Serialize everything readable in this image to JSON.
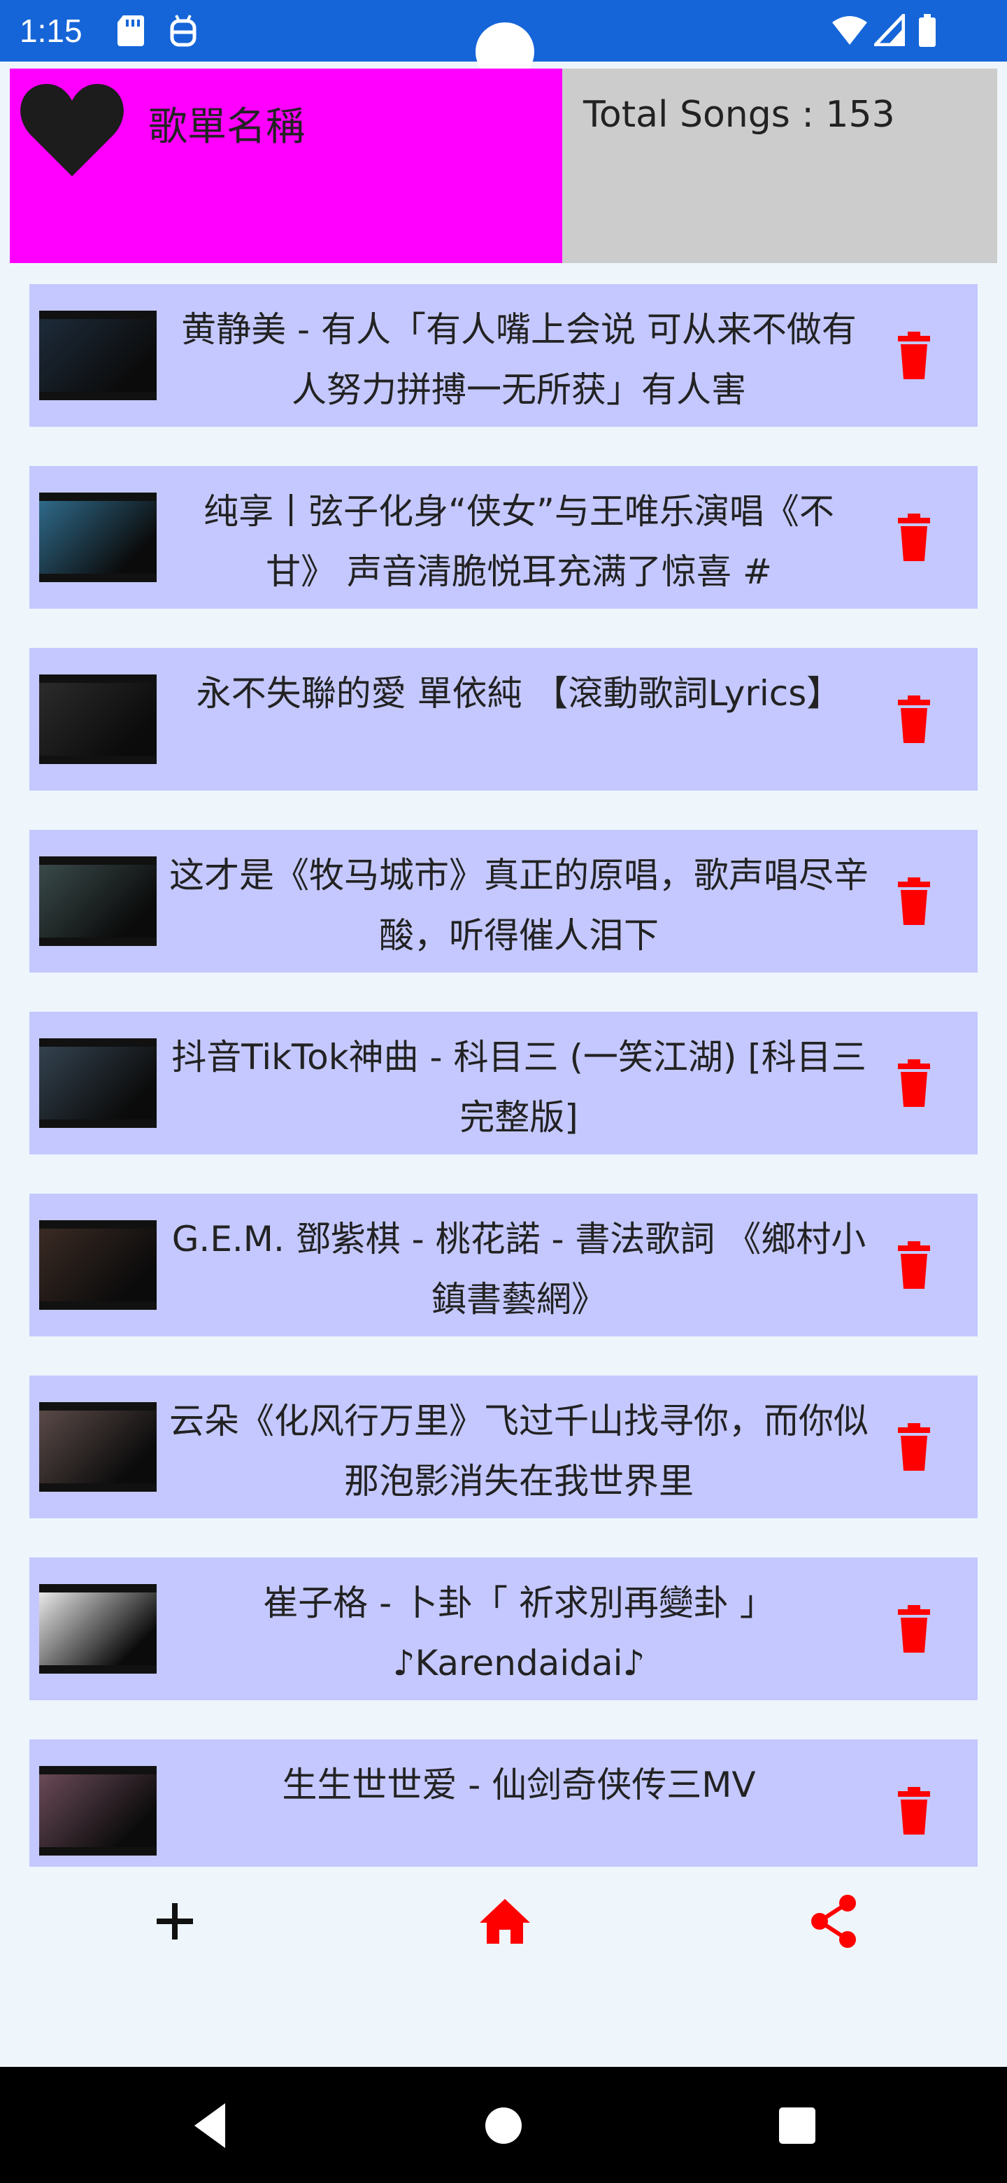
{
  "status_bar": {
    "time": "1:15",
    "icons": [
      "sd-card-icon",
      "android-debug-icon",
      "wifi-icon",
      "signal-icon",
      "battery-icon"
    ]
  },
  "header": {
    "playlist_name": "歌單名稱",
    "total_songs": "Total Songs : 153",
    "colors": {
      "left": "#ff00ff",
      "right": "#cccccc"
    }
  },
  "songs": [
    {
      "title": "黄静美 - 有人「有人嘴上会说 可从来不做有人努力拼搏一无所获」有人害",
      "thumb_color": "#1d2b3a"
    },
    {
      "title": "纯享丨弦子化身“侠女”与王唯乐演唱《不甘》 声音清脆悦耳充满了惊喜 #",
      "thumb_color": "#2f6a8a"
    },
    {
      "title": "永不失聯的愛 單依純 【滾動歌詞Lyrics】",
      "thumb_color": "#2b2b2b"
    },
    {
      "title": "这才是《牧马城市》真正的原唱，歌声唱尽辛酸，听得催人泪下",
      "thumb_color": "#3a4a4a"
    },
    {
      "title": "抖音TikTok神曲 - 科目三 (一笑江湖) [科目三完整版]",
      "thumb_color": "#33424f"
    },
    {
      "title": "G.E.M. 鄧紫棋 - 桃花諾 - 書法歌詞 《鄉村小鎮書藝網》",
      "thumb_color": "#3a2a24"
    },
    {
      "title": "云朵《化风行万里》飞过千山找寻你，而你似那泡影消失在我世界里",
      "thumb_color": "#5a4a48"
    },
    {
      "title": "崔子格 - 卜卦「 祈求別再變卦 」♪Karendaidai♪",
      "thumb_color": "#e8e8e8"
    },
    {
      "title": "生生世世爱 - 仙剑奇侠传三MV",
      "thumb_color": "#6a4a58"
    }
  ],
  "actions": {
    "add": "add-icon",
    "home": "home-icon",
    "share": "share-icon",
    "accent": "#ff0000"
  },
  "nav": [
    "back-icon",
    "home-circle-icon",
    "recents-icon"
  ]
}
